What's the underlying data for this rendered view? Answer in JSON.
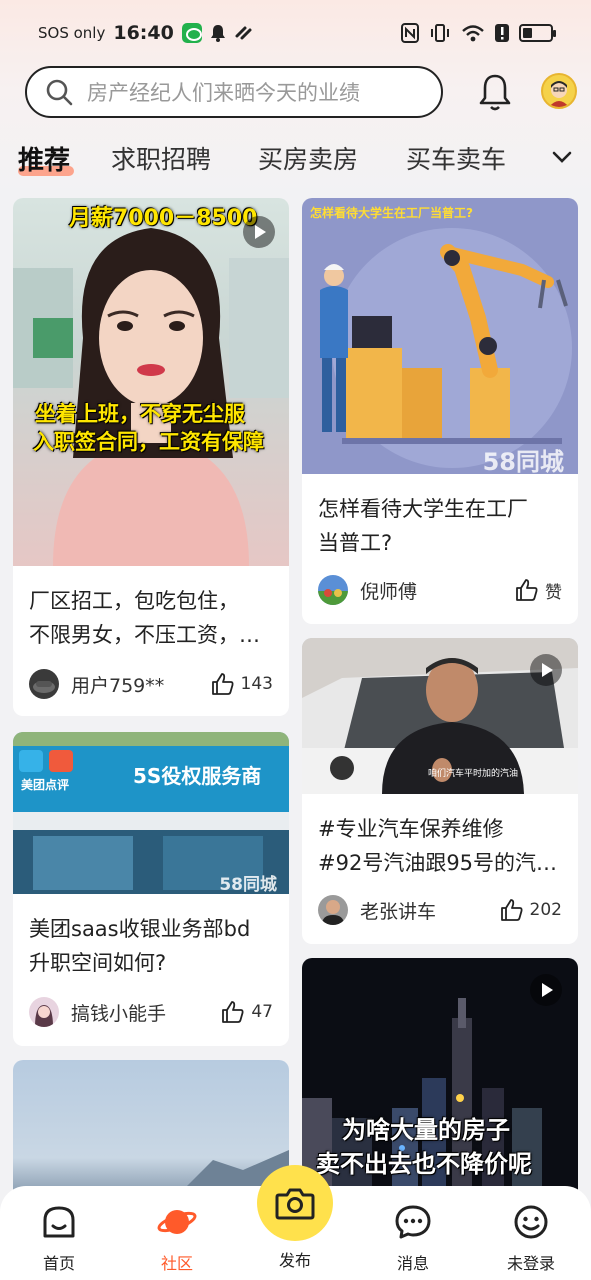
{
  "status_bar": {
    "carrier": "SOS only",
    "time": "16:40"
  },
  "search": {
    "placeholder": "房产经纪人们来晒今天的业绩"
  },
  "tabs": [
    {
      "label": "推荐",
      "active": true
    },
    {
      "label": "求职招聘",
      "active": false
    },
    {
      "label": "买房卖房",
      "active": false
    },
    {
      "label": "买车卖车",
      "active": false
    }
  ],
  "feed": {
    "left": [
      {
        "overlay_top": "月薪7000－8500",
        "overlay_bottom_1": "坐着上班，不穿无尘服",
        "overlay_bottom_2": "入职签合同，工资有保障",
        "title_line1": "厂区招工，包吃包住，",
        "title_line2": "不限男女，不压工资，…",
        "author": "用户759**",
        "likes": "143",
        "is_video": true
      },
      {
        "sign_text": "5S役权服务商",
        "logo_text": "美团点评",
        "watermark": "58同城",
        "title_line1": "美团saas收银业务部bd",
        "title_line2": "升职空间如何?",
        "author": "搞钱小能手",
        "likes": "47",
        "is_video": false
      }
    ],
    "right": [
      {
        "image_caption": "怎样看待大学生在工厂当普工?",
        "watermark": "58同城",
        "title_line1": "怎样看待大学生在工厂",
        "title_line2": "当普工?",
        "author": "倪师傅",
        "likes": "赞",
        "is_video": false
      },
      {
        "subtitle": "咱们汽车平时加的汽油",
        "title_line1": "#专业汽车保养维修",
        "title_line2": "#92号汽油跟95号的汽…",
        "author": "老张讲车",
        "likes": "202",
        "is_video": true
      },
      {
        "overlay_1": "为啥大量的房子",
        "overlay_2": "卖不出去也不降价呢",
        "is_video": true
      }
    ]
  },
  "bottom_nav": {
    "home": "首页",
    "community": "社区",
    "publish": "发布",
    "messages": "消息",
    "login": "未登录"
  },
  "colors": {
    "accent": "#ff5a2a",
    "publish": "#ffe14c",
    "tab_underline": "#ff8a6a"
  }
}
